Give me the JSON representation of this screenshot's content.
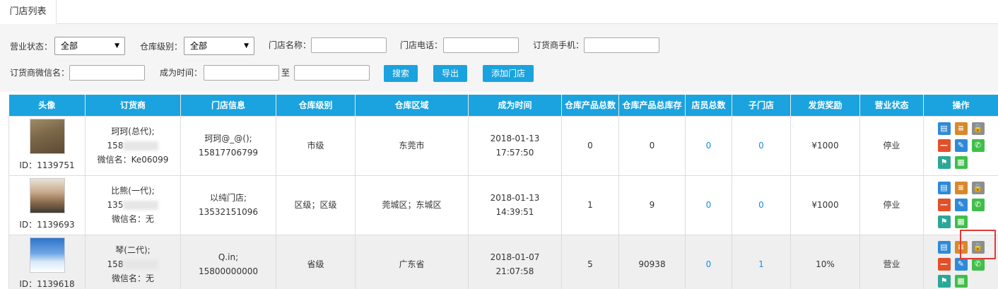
{
  "tabs": {
    "active": "门店列表"
  },
  "filters": {
    "biz_status_label": "营业状态：",
    "biz_status_value": "全部",
    "warehouse_level_label": "仓库级别：",
    "warehouse_level_value": "全部",
    "store_name_label": "门店名称：",
    "store_phone_label": "门店电话：",
    "supplier_phone_label": "订货商手机：",
    "wechat_label": "订货商微信名：",
    "became_time_label": "成为时间：",
    "to_label": "至",
    "search_btn": "搜索",
    "export_btn": "导出",
    "add_btn": "添加门店"
  },
  "table": {
    "headers": [
      "头像",
      "订货商",
      "门店信息",
      "仓库级别",
      "仓库区域",
      "成为时间",
      "仓库产品总数",
      "仓库产品总库存",
      "店员总数",
      "子门店",
      "发货奖励",
      "营业状态",
      "操作"
    ],
    "rows": [
      {
        "id": "ID：1139751",
        "supplier": "珂珂(总代);",
        "phone": "158",
        "wechat": "微信名：Ke06099",
        "store_name": "珂珂@_@();",
        "store_phone": "15817706799",
        "level": "市级",
        "area": "东莞市",
        "date": "2018-01-13",
        "time": "17:57:50",
        "product_count": "0",
        "stock": "0",
        "staff": "0",
        "sub_stores": "0",
        "reward": "¥1000",
        "status": "停业"
      },
      {
        "id": "ID：1139693",
        "supplier": "比熊(一代);",
        "phone": "135",
        "wechat": "微信名：无",
        "store_name": "以纯门店;",
        "store_phone": "13532151096",
        "level": "区级；区级",
        "area": "莞城区；东城区",
        "date": "2018-01-13",
        "time": "14:39:51",
        "product_count": "1",
        "stock": "9",
        "staff": "0",
        "sub_stores": "0",
        "reward": "¥1000",
        "status": "停业"
      },
      {
        "id": "ID：1139618",
        "supplier": "琴(二代);",
        "phone": "158",
        "wechat": "微信名：无",
        "store_name": "Q.in;",
        "store_phone": "15800000000",
        "level": "省级",
        "area": "广东省",
        "date": "2018-01-07",
        "time": "21:07:58",
        "product_count": "5",
        "stock": "90938",
        "staff": "0",
        "sub_stores": "1",
        "reward": "10%",
        "status": "营业"
      }
    ]
  },
  "icons": [
    "chart-icon",
    "list-icon",
    "lock-icon",
    "minus-icon",
    "edit-icon",
    "phone-icon",
    "flag-icon",
    "document-icon"
  ],
  "colors": {
    "header_bg": "#1aa3de",
    "link": "#1a8fdc",
    "highlight": "#e53935"
  }
}
